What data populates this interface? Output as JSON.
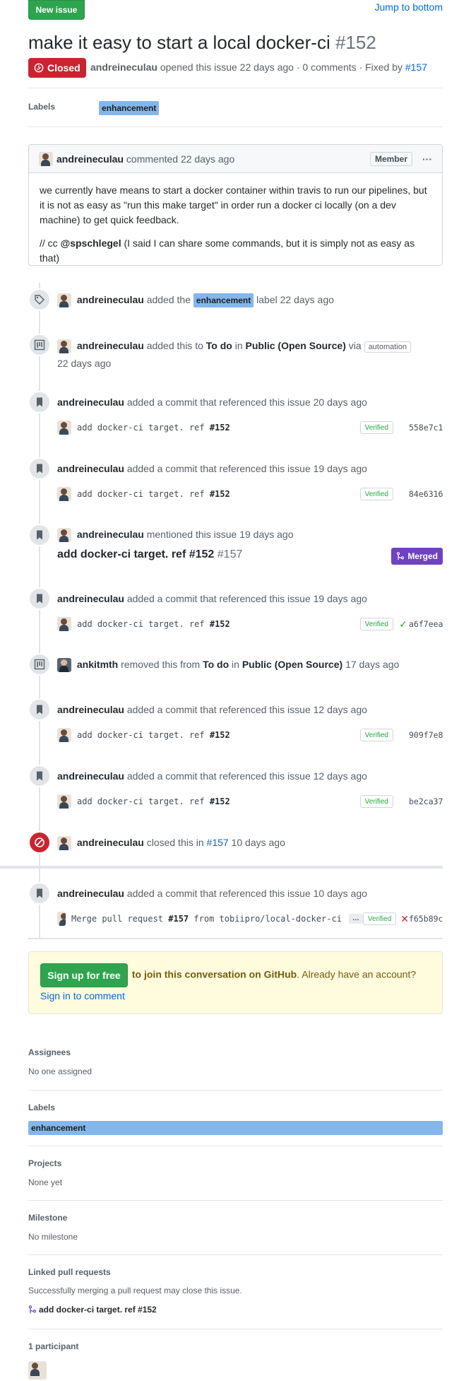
{
  "header": {
    "new_issue_label": "New issue",
    "jump_label": "Jump to bottom",
    "title": "make it easy to start a local docker-ci",
    "number": "#152",
    "state": "Closed",
    "author": "andreineculau",
    "meta_text": "opened this issue 22 days ago · 0 comments · Fixed by",
    "fixed_by": "#157"
  },
  "labels_row": {
    "heading": "Labels",
    "label": "enhancement"
  },
  "comment": {
    "author": "andreineculau",
    "action": "commented 22 days ago",
    "role": "Member",
    "more": "···",
    "para1": "we currently have means to start a docker container within travis to run our pipelines, but it is not as easy as \"run this make target\" in order run a docker ci locally (on a dev machine) to get quick feedback.",
    "para2_pre": "// cc",
    "para2_mention": "@spschlegel",
    "para2_post": "(I said I can share some commands, but it is simply not as easy as that)"
  },
  "timeline": {
    "e1": {
      "user": "andreineculau",
      "pre": "added the",
      "label": "enhancement",
      "post": "label 22 days ago"
    },
    "e2": {
      "user": "andreineculau",
      "t1": "added this to",
      "col": "To do",
      "t2": "in",
      "proj": "Public (Open Source)",
      "t3": "via",
      "via": "automation",
      "time": "22 days ago"
    },
    "c1": {
      "user": "andreineculau",
      "text": "added a commit that referenced this issue 20 days ago",
      "msg": "add docker-ci target. ref",
      "ref": "#152",
      "verified": "Verified",
      "sha": "558e7c1"
    },
    "c2": {
      "user": "andreineculau",
      "text": "added a commit that referenced this issue 19 days ago",
      "msg": "add docker-ci target. ref",
      "ref": "#152",
      "verified": "Verified",
      "sha": "84e6316"
    },
    "m1": {
      "user": "andreineculau",
      "text": "mentioned this issue 19 days ago",
      "pr_title": "add docker-ci target. ref #152",
      "pr_num": "#157",
      "state": "Merged"
    },
    "c3": {
      "user": "andreineculau",
      "text": "added a commit that referenced this issue 19 days ago",
      "msg": "add docker-ci target. ref",
      "ref": "#152",
      "verified": "Verified",
      "check": "✓",
      "sha": "a6f7eea"
    },
    "r1": {
      "user": "ankitmth",
      "t1": "removed this from",
      "col": "To do",
      "t2": "in",
      "proj": "Public (Open Source)",
      "time": "17 days ago"
    },
    "c4": {
      "user": "andreineculau",
      "text": "added a commit that referenced this issue 12 days ago",
      "msg": "add docker-ci target. ref",
      "ref": "#152",
      "verified": "Verified",
      "sha": "909f7e8"
    },
    "c5": {
      "user": "andreineculau",
      "text": "added a commit that referenced this issue 12 days ago",
      "msg": "add docker-ci target. ref",
      "ref": "#152",
      "verified": "Verified",
      "sha": "be2ca37"
    },
    "x1": {
      "user": "andreineculau",
      "pre": "closed this in",
      "pr": "#157",
      "time": "10 days ago"
    },
    "c6": {
      "user": "andreineculau",
      "text": "added a commit that referenced this issue 10 days ago",
      "msg_pre": "Merge pull request",
      "msg_ref": "#157",
      "msg_post": "from tobiipro/local-docker-ci",
      "ellipsis": "…",
      "verified": "Verified",
      "check": "✕",
      "sha": "f65b89c"
    }
  },
  "signup": {
    "button": "Sign up for free",
    "text": "to join this conversation on GitHub",
    "text2": ". Already have an account?",
    "link": "Sign in to comment"
  },
  "sidebar": {
    "assignees_h": "Assignees",
    "assignees_v": "No one assigned",
    "labels_h": "Labels",
    "labels_v": "enhancement",
    "projects_h": "Projects",
    "projects_v": "None yet",
    "milestone_h": "Milestone",
    "milestone_v": "No milestone",
    "linked_h": "Linked pull requests",
    "linked_note": "Successfully merging a pull request may close this issue.",
    "linked_pr": "add docker-ci target. ref #152",
    "participants_h": "1 participant"
  },
  "colors": {
    "green": "#2ea44f",
    "closed_red": "#cb2431",
    "merged_purple": "#6f42c1",
    "label_blue": "#84b6eb",
    "link": "#0366d6"
  }
}
